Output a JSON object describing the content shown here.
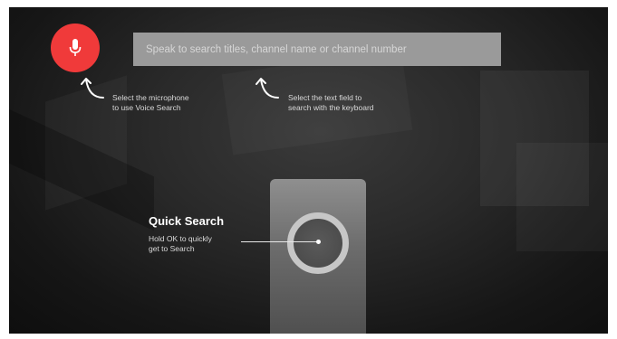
{
  "search": {
    "placeholder": "Speak to search titles, channel name or channel number"
  },
  "hints": {
    "microphone": {
      "line1": "Select the microphone",
      "line2": "to use Voice Search"
    },
    "text_field": {
      "line1": "Select the text field to",
      "line2": "search with the keyboard"
    }
  },
  "quick_search": {
    "title": "Quick Search",
    "line1": "Hold OK to quickly",
    "line2": "get to Search"
  },
  "icons": {
    "mic": "microphone-icon",
    "arrow": "curved-arrow-up-icon"
  },
  "colors": {
    "mic_button": "#f03a3a",
    "search_field": "#9a9a9a",
    "background": "#1f1f1f"
  }
}
